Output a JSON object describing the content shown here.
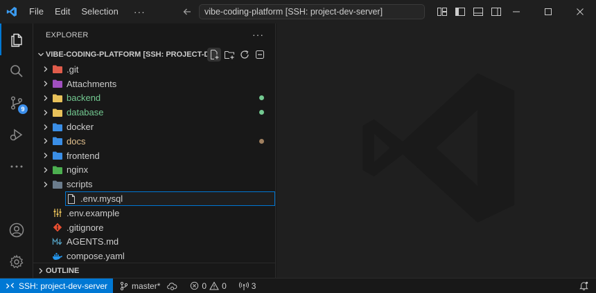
{
  "titlebar": {
    "menu": [
      "File",
      "Edit",
      "Selection"
    ],
    "command_center": "vibe-coding-platform [SSH: project-dev-server]"
  },
  "activitybar": {
    "items": [
      "explorer-icon",
      "search-icon",
      "source-control-icon",
      "run-debug-icon",
      "more-icon",
      "account-icon",
      "settings-icon"
    ],
    "source_control_badge": "9"
  },
  "explorer": {
    "header": "EXPLORER",
    "root_title": "VIBE-CODING-PLATFORM [SSH: PROJECT-DE...",
    "items": [
      {
        "label": ".git",
        "kind": "folder",
        "icon_color": "#e05c4b",
        "label_color": "#cccccc"
      },
      {
        "label": "Attachments",
        "kind": "folder",
        "icon_color": "#a04fbf",
        "label_color": "#cccccc"
      },
      {
        "label": "backend",
        "kind": "folder",
        "icon_color": "#e8c15a",
        "label_color": "#73c991",
        "dot": "#73c991"
      },
      {
        "label": "database",
        "kind": "folder",
        "icon_color": "#e8c15a",
        "label_color": "#73c991",
        "dot": "#73c991"
      },
      {
        "label": "docker",
        "kind": "folder",
        "icon_color": "#3a8ee6",
        "label_color": "#cccccc"
      },
      {
        "label": "docs",
        "kind": "folder",
        "icon_color": "#3a8ee6",
        "label_color": "#e2c08d",
        "dot": "#a08060"
      },
      {
        "label": "frontend",
        "kind": "folder",
        "icon_color": "#3a8ee6",
        "label_color": "#cccccc"
      },
      {
        "label": "nginx",
        "kind": "folder",
        "icon_color": "#4caf50",
        "label_color": "#cccccc"
      },
      {
        "label": "scripts",
        "kind": "folder",
        "icon_color": "#6b7c8c",
        "label_color": "#cccccc"
      },
      {
        "label": ".env.mysql",
        "kind": "file",
        "icon": "file-icon",
        "label_color": "#cccccc",
        "selected": true
      },
      {
        "label": ".env.example",
        "kind": "file",
        "icon": "env-icon",
        "label_color": "#cccccc"
      },
      {
        "label": ".gitignore",
        "kind": "file",
        "icon": "git-icon",
        "label_color": "#cccccc"
      },
      {
        "label": "AGENTS.md",
        "kind": "file",
        "icon": "markdown-icon",
        "label_color": "#cccccc"
      },
      {
        "label": "compose.yaml",
        "kind": "file",
        "icon": "docker-icon",
        "label_color": "#cccccc"
      }
    ],
    "outline": "OUTLINE"
  },
  "statusbar": {
    "remote": "SSH: project-dev-server",
    "branch": "master*",
    "errors": "0",
    "warnings": "0",
    "ports": "3"
  }
}
